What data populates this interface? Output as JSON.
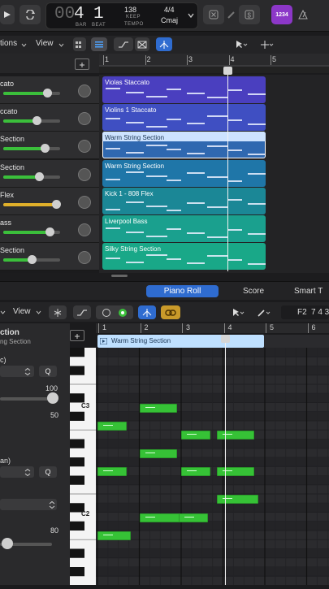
{
  "lcd": {
    "bar_prefix": "00",
    "bar": "4",
    "beat": "1",
    "bar_label": "BAR",
    "beat_label": "BEAT",
    "tempo": "138",
    "tempo_mode": "KEEP",
    "tempo_label": "TEMPO",
    "time_signature": "4/4",
    "key": "Cmaj"
  },
  "topbar": {
    "count_in": "1234"
  },
  "tracks_toolbar": {
    "functions_label": "tions",
    "view_label": "View"
  },
  "ruler_bars": [
    "1",
    "2",
    "3",
    "4",
    "5"
  ],
  "tracks": [
    {
      "name": "cato",
      "region": "Violas Staccato",
      "color": "#4a3fbf",
      "meter": 0.82,
      "meter_color": "#3bbf3b"
    },
    {
      "name": "ccato",
      "region": "Violins 1 Staccato",
      "color": "#3f4fc2",
      "meter": 0.6,
      "meter_color": "#3bbf3b"
    },
    {
      "name": "Section",
      "region": "Warm String Section",
      "color": "#2f68b0",
      "meter": 0.78,
      "meter_color": "#3bbf3b"
    },
    {
      "name": "Section",
      "region": "Warm String Section",
      "color": "#1f76a8",
      "meter": 0.65,
      "meter_color": "#3bbf3b"
    },
    {
      "name": "Flex",
      "region": "Kick 1 - 808 Flex",
      "color": "#1b8796",
      "meter": 1.0,
      "meter_color": "#e0b02a"
    },
    {
      "name": "ass",
      "region": "Liverpool Bass",
      "color": "#1aa08e",
      "meter": 0.87,
      "meter_color": "#3bbf3b"
    },
    {
      "name": "Section",
      "region": "Silky String Section",
      "color": "#19a888",
      "meter": 0.5,
      "meter_color": "#3bbf3b"
    }
  ],
  "editor_tabs": {
    "piano_roll": "Piano Roll",
    "score": "Score",
    "smart_tempo": "Smart T"
  },
  "pr_toolbar": {
    "view_label": "View",
    "pitch_label": "F2",
    "position_label": "7 4 3"
  },
  "inspector": {
    "title": "ction",
    "subtitle": "ng Section",
    "field1_label": "c)",
    "q_label": "Q",
    "value_100": "100",
    "value_50": "50",
    "field2_label": "an)",
    "value_80": "80"
  },
  "pr_ruler": [
    "1",
    "2",
    "3",
    "4",
    "5",
    "6"
  ],
  "pr_region_name": "Warm String Section",
  "key_labels": {
    "c3": "C3",
    "c2": "C2"
  },
  "piano_notes": [
    {
      "start": 2.0,
      "length": 0.9,
      "pitch": 62
    },
    {
      "start": 1.0,
      "length": 0.7,
      "pitch": 60
    },
    {
      "start": 3.0,
      "length": 0.7,
      "pitch": 59
    },
    {
      "start": 3.85,
      "length": 0.9,
      "pitch": 59
    },
    {
      "start": 2.0,
      "length": 0.9,
      "pitch": 57
    },
    {
      "start": 1.0,
      "length": 0.7,
      "pitch": 55
    },
    {
      "start": 3.0,
      "length": 0.7,
      "pitch": 55
    },
    {
      "start": 3.85,
      "length": 0.9,
      "pitch": 55
    },
    {
      "start": 3.85,
      "length": 1.0,
      "pitch": 52
    },
    {
      "start": 2.0,
      "length": 1.0,
      "pitch": 50
    },
    {
      "start": 2.95,
      "length": 0.7,
      "pitch": 50
    },
    {
      "start": 1.0,
      "length": 0.8,
      "pitch": 48
    }
  ],
  "playhead_bar": 4.0
}
